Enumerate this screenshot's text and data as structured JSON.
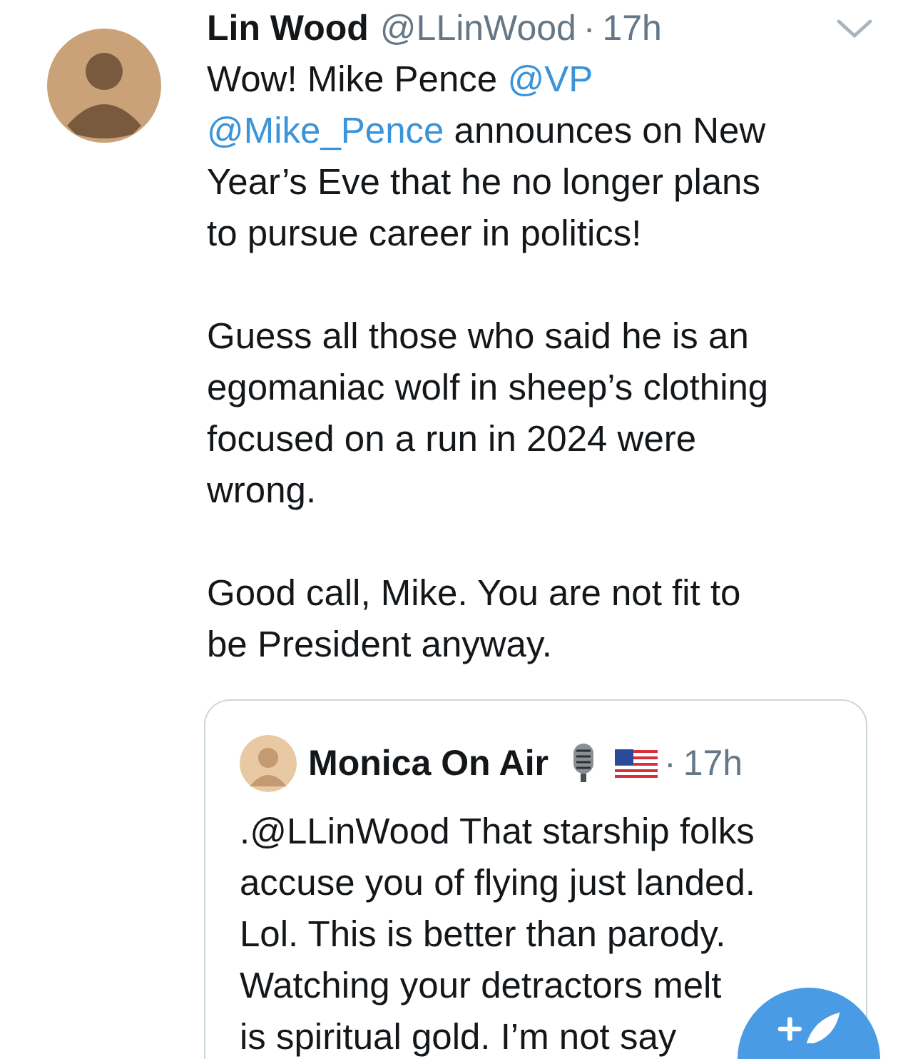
{
  "tweet": {
    "author": {
      "name": "Lin Wood",
      "handle": "@LLinWood",
      "separator": "·",
      "time": "17h"
    },
    "paragraphs": [
      [
        [
          {
            "text": "Wow! Mike Pence ",
            "kind": "plain"
          },
          {
            "text": "@VP",
            "kind": "mention"
          }
        ],
        [
          {
            "text": "@Mike_Pence",
            "kind": "mention"
          },
          {
            "text": " announces on New",
            "kind": "plain"
          }
        ],
        [
          {
            "text": "Year’s Eve that he no longer plans",
            "kind": "plain"
          }
        ],
        [
          {
            "text": "to pursue career in politics!",
            "kind": "plain"
          }
        ]
      ],
      [
        [
          {
            "text": "Guess all those who said he is an",
            "kind": "plain"
          }
        ],
        [
          {
            "text": "egomaniac wolf in sheep’s clothing",
            "kind": "plain"
          }
        ],
        [
          {
            "text": "focused on a run in 2024 were",
            "kind": "plain"
          }
        ],
        [
          {
            "text": "wrong.",
            "kind": "plain"
          }
        ]
      ],
      [
        [
          {
            "text": "Good call, Mike. You are not fit to",
            "kind": "plain"
          }
        ],
        [
          {
            "text": "be President anyway.",
            "kind": "plain"
          }
        ]
      ]
    ],
    "quoted": {
      "author": {
        "name": "Monica On Air",
        "separator": "·",
        "time": "17h"
      },
      "lines": [
        ".@LLinWood That starship folks",
        "accuse you of flying just landed.",
        "Lol. This is better than parody.",
        "Watching your detractors melt",
        "is spiritual gold. I’m not say"
      ]
    }
  }
}
